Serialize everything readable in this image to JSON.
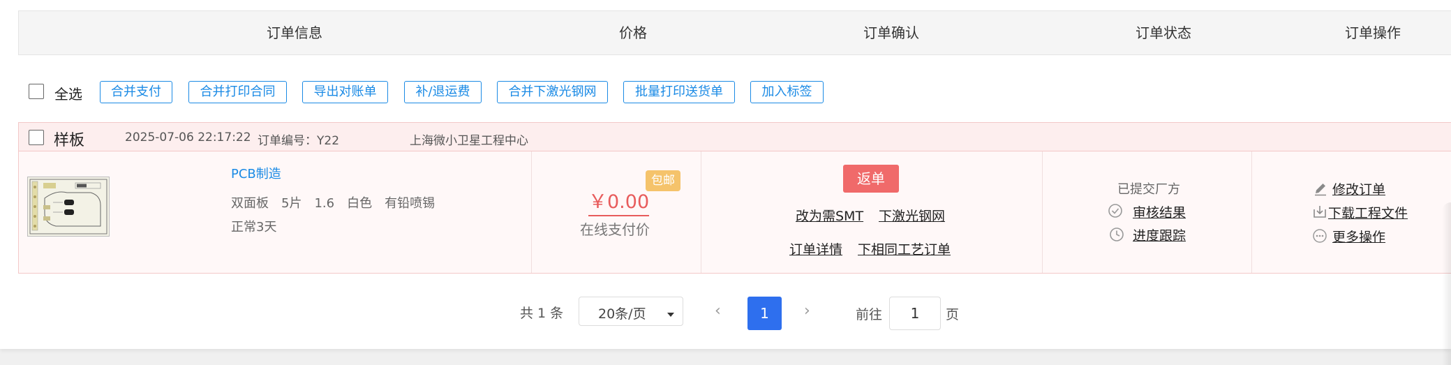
{
  "table_header": {
    "col_info": "订单信息",
    "col_price": "价格",
    "col_confirm": "订单确认",
    "col_status": "订单状态",
    "col_actions": "订单操作"
  },
  "toolbar": {
    "select_all": "全选",
    "buttons": [
      "合并支付",
      "合并打印合同",
      "导出对账单",
      "补/退运费",
      "合并下激光钢网",
      "批量打印送货单",
      "加入标签"
    ]
  },
  "order": {
    "type": "样板",
    "datetime": "2025-07-06 22:17:22",
    "order_no": "订单编号：Y22",
    "company": "上海微小卫星工程中心",
    "product_link": "PCB制造",
    "specs": [
      "双面板",
      "5片",
      "1.6",
      "白色",
      "有铅喷锡"
    ],
    "lead_time": "正常3天",
    "price": "￥0.00",
    "free_shipping_badge": "包邮",
    "price_note": "在线支付价",
    "return_button": "返单",
    "confirm_links": [
      "改为需SMT",
      "下激光钢网",
      "订单详情",
      "下相同工艺订单"
    ],
    "status_text": "已提交厂方",
    "status_links": [
      "审核结果",
      "进度跟踪"
    ],
    "action_links": [
      "修改订单",
      "下载工程文件",
      "更多操作"
    ],
    "icons": {
      "audit": "check-circle-icon",
      "progress": "clock-icon",
      "edit": "pencil-icon",
      "download": "download-icon",
      "more": "more-dots-icon"
    }
  },
  "pagination": {
    "total": "共 1 条",
    "page_size": "20条/页",
    "current_page": "1",
    "goto_label": "前往",
    "goto_value": "1",
    "page_suffix": "页"
  },
  "colors": {
    "accent_blue": "#1a8ae5",
    "page_active": "#2e6fee",
    "return_red": "#f06a6a",
    "price_red": "#e85c5c",
    "badge_orange": "#f5c36b",
    "row_pink": "#fdeeee"
  }
}
